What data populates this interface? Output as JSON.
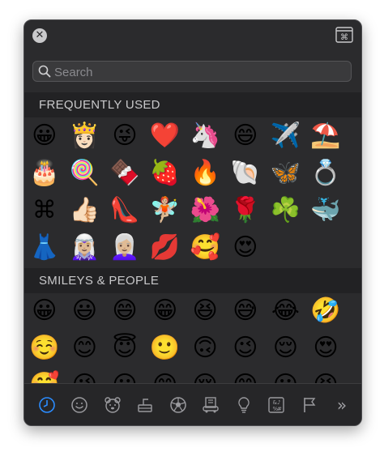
{
  "search": {
    "placeholder": "Search"
  },
  "sections": {
    "frequent": {
      "title": "FREQUENTLY USED",
      "emojis": [
        "😀",
        "👸🏻",
        "😜",
        "❤️",
        "🦄",
        "😄",
        "✈️",
        "⛱️",
        "🎂",
        "🍭",
        "🍫",
        "🍓",
        "🔥",
        "🐚",
        "🦋",
        "💍",
        "⌘",
        "👍🏻",
        "👠",
        "🧚🏼",
        "🌺",
        "🌹",
        "☘️",
        "🐳",
        "👗",
        "🧝🏼‍♀️",
        "👩🏼‍🦳",
        "💋",
        "🥰",
        "😍"
      ]
    },
    "smileys": {
      "title": "SMILEYS & PEOPLE",
      "emojis": [
        "😀",
        "😃",
        "😄",
        "😁",
        "😆",
        "😅",
        "😂",
        "🤣",
        "☺️",
        "😊",
        "😇",
        "🙂",
        "🙃",
        "😉",
        "😌",
        "😍",
        "🥰",
        "😘",
        "😗",
        "😙",
        "😚",
        "😋",
        "😛",
        "😝"
      ]
    }
  },
  "tabs": [
    "recent-icon",
    "smiley-icon",
    "animal-icon",
    "food-icon",
    "ball-icon",
    "building-icon",
    "lightbulb-icon",
    "symbols-icon",
    "flag-icon",
    "more-icon"
  ],
  "colors": {
    "panel": "#2b2b2d",
    "header": "#222224",
    "active": "#2b8cff"
  }
}
